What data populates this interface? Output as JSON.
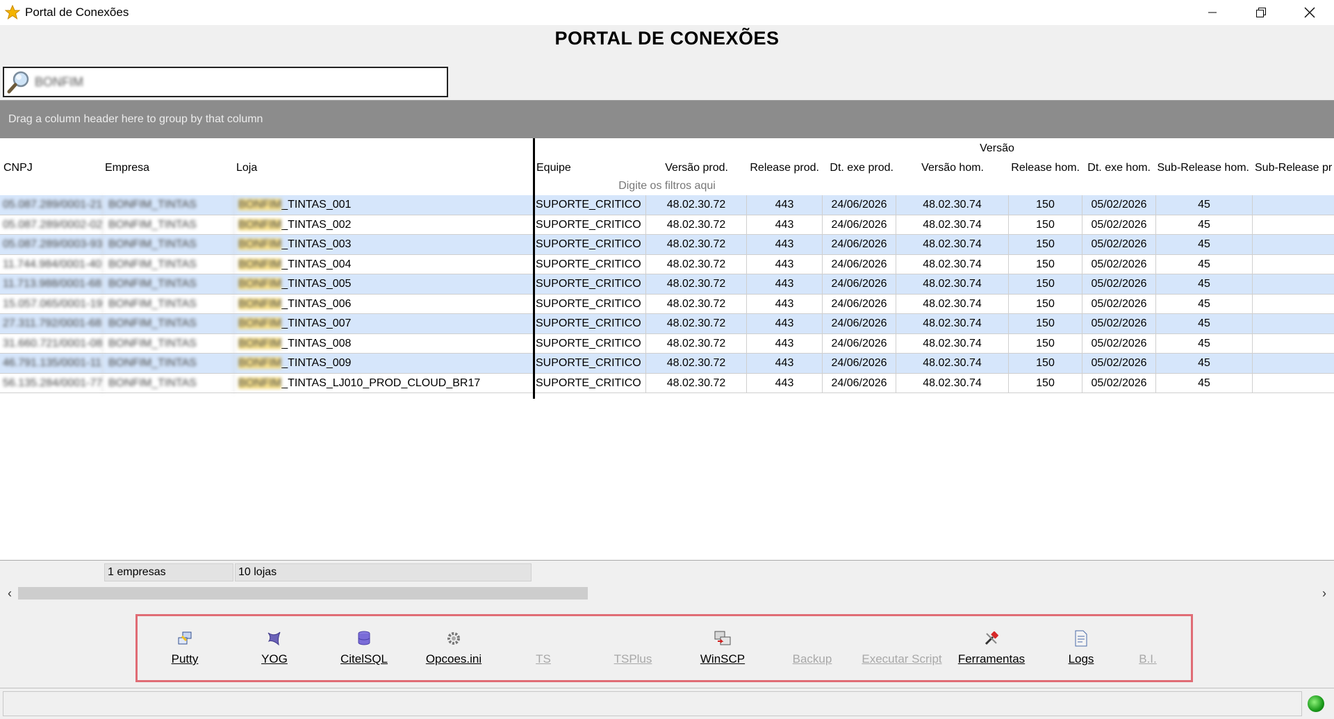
{
  "window": {
    "title": "Portal de Conexões"
  },
  "heading": "PORTAL DE CONEXÕES",
  "search": {
    "value": "BONFIM"
  },
  "grid": {
    "group_hint": "Drag a column header here to group by that column",
    "group_header": "Versão",
    "columns": [
      "CNPJ",
      "Empresa",
      "Loja",
      "Equipe",
      "Versão prod.",
      "Release prod.",
      "Dt. exe prod.",
      "Versão hom.",
      "Release hom.",
      "Dt. exe hom.",
      "Sub-Release hom.",
      "Sub-Release pr"
    ],
    "filter_hint": "Digite os filtros aqui",
    "rows": [
      {
        "cnpj": "05.087.289/0001-21",
        "empresa": "BONFIM_TINTAS",
        "loja_prefix": "BONFIM",
        "loja": "_TINTAS_001",
        "equipe": "SUPORTE_CRITICO",
        "versao_prod": "48.02.30.72",
        "release_prod": "443",
        "dt_exe_prod": "24/06/2026",
        "versao_hom": "48.02.30.74",
        "release_hom": "150",
        "dt_exe_hom": "05/02/2026",
        "sub_release_hom": "45"
      },
      {
        "cnpj": "05.087.289/0002-02",
        "empresa": "BONFIM_TINTAS",
        "loja_prefix": "BONFIM",
        "loja": "_TINTAS_002",
        "equipe": "SUPORTE_CRITICO",
        "versao_prod": "48.02.30.72",
        "release_prod": "443",
        "dt_exe_prod": "24/06/2026",
        "versao_hom": "48.02.30.74",
        "release_hom": "150",
        "dt_exe_hom": "05/02/2026",
        "sub_release_hom": "45"
      },
      {
        "cnpj": "05.087.289/0003-93",
        "empresa": "BONFIM_TINTAS",
        "loja_prefix": "BONFIM",
        "loja": "_TINTAS_003",
        "equipe": "SUPORTE_CRITICO",
        "versao_prod": "48.02.30.72",
        "release_prod": "443",
        "dt_exe_prod": "24/06/2026",
        "versao_hom": "48.02.30.74",
        "release_hom": "150",
        "dt_exe_hom": "05/02/2026",
        "sub_release_hom": "45"
      },
      {
        "cnpj": "11.744.984/0001-40",
        "empresa": "BONFIM_TINTAS",
        "loja_prefix": "BONFIM",
        "loja": "_TINTAS_004",
        "equipe": "SUPORTE_CRITICO",
        "versao_prod": "48.02.30.72",
        "release_prod": "443",
        "dt_exe_prod": "24/06/2026",
        "versao_hom": "48.02.30.74",
        "release_hom": "150",
        "dt_exe_hom": "05/02/2026",
        "sub_release_hom": "45"
      },
      {
        "cnpj": "11.713.988/0001-68",
        "empresa": "BONFIM_TINTAS",
        "loja_prefix": "BONFIM",
        "loja": "_TINTAS_005",
        "equipe": "SUPORTE_CRITICO",
        "versao_prod": "48.02.30.72",
        "release_prod": "443",
        "dt_exe_prod": "24/06/2026",
        "versao_hom": "48.02.30.74",
        "release_hom": "150",
        "dt_exe_hom": "05/02/2026",
        "sub_release_hom": "45"
      },
      {
        "cnpj": "15.057.065/0001-19",
        "empresa": "BONFIM_TINTAS",
        "loja_prefix": "BONFIM",
        "loja": "_TINTAS_006",
        "equipe": "SUPORTE_CRITICO",
        "versao_prod": "48.02.30.72",
        "release_prod": "443",
        "dt_exe_prod": "24/06/2026",
        "versao_hom": "48.02.30.74",
        "release_hom": "150",
        "dt_exe_hom": "05/02/2026",
        "sub_release_hom": "45"
      },
      {
        "cnpj": "27.311.792/0001-68",
        "empresa": "BONFIM_TINTAS",
        "loja_prefix": "BONFIM",
        "loja": "_TINTAS_007",
        "equipe": "SUPORTE_CRITICO",
        "versao_prod": "48.02.30.72",
        "release_prod": "443",
        "dt_exe_prod": "24/06/2026",
        "versao_hom": "48.02.30.74",
        "release_hom": "150",
        "dt_exe_hom": "05/02/2026",
        "sub_release_hom": "45"
      },
      {
        "cnpj": "31.660.721/0001-08",
        "empresa": "BONFIM_TINTAS",
        "loja_prefix": "BONFIM",
        "loja": "_TINTAS_008",
        "equipe": "SUPORTE_CRITICO",
        "versao_prod": "48.02.30.72",
        "release_prod": "443",
        "dt_exe_prod": "24/06/2026",
        "versao_hom": "48.02.30.74",
        "release_hom": "150",
        "dt_exe_hom": "05/02/2026",
        "sub_release_hom": "45"
      },
      {
        "cnpj": "46.791.135/0001-11",
        "empresa": "BONFIM_TINTAS",
        "loja_prefix": "BONFIM",
        "loja": "_TINTAS_009",
        "equipe": "SUPORTE_CRITICO",
        "versao_prod": "48.02.30.72",
        "release_prod": "443",
        "dt_exe_prod": "24/06/2026",
        "versao_hom": "48.02.30.74",
        "release_hom": "150",
        "dt_exe_hom": "05/02/2026",
        "sub_release_hom": "45"
      },
      {
        "cnpj": "56.135.284/0001-77",
        "empresa": "BONFIM_TINTAS",
        "loja_prefix": "BONFIM",
        "loja": "_TINTAS_LJ010_PROD_CLOUD_BR17",
        "equipe": "SUPORTE_CRITICO",
        "versao_prod": "48.02.30.72",
        "release_prod": "443",
        "dt_exe_prod": "24/06/2026",
        "versao_hom": "48.02.30.74",
        "release_hom": "150",
        "dt_exe_hom": "05/02/2026",
        "sub_release_hom": "45"
      }
    ],
    "summary": {
      "empresas": "1 empresas",
      "lojas": "10 lojas"
    }
  },
  "toolbar": [
    {
      "label": "Putty",
      "icon": "putty-icon",
      "enabled": true
    },
    {
      "label": "YOG",
      "icon": "yog-icon",
      "enabled": true
    },
    {
      "label": "CitelSQL",
      "icon": "database-icon",
      "enabled": true
    },
    {
      "label": "Opcoes.ini",
      "icon": "gear-icon",
      "enabled": true
    },
    {
      "label": "TS",
      "icon": "",
      "enabled": false
    },
    {
      "label": "TSPlus",
      "icon": "",
      "enabled": false
    },
    {
      "label": "WinSCP",
      "icon": "winscp-icon",
      "enabled": true
    },
    {
      "label": "Backup",
      "icon": "",
      "enabled": false
    },
    {
      "label": "Executar Script",
      "icon": "",
      "enabled": false
    },
    {
      "label": "Ferramentas",
      "icon": "tools-icon",
      "enabled": true
    },
    {
      "label": "Logs",
      "icon": "log-file-icon",
      "enabled": true
    },
    {
      "label": "B.I.",
      "icon": "",
      "enabled": false
    }
  ],
  "colors": {
    "accent_border": "#e06c75",
    "row_alt": "#d6e6fb",
    "group_bar": "#8c8c8c",
    "status_led": "#1a9a1a"
  }
}
